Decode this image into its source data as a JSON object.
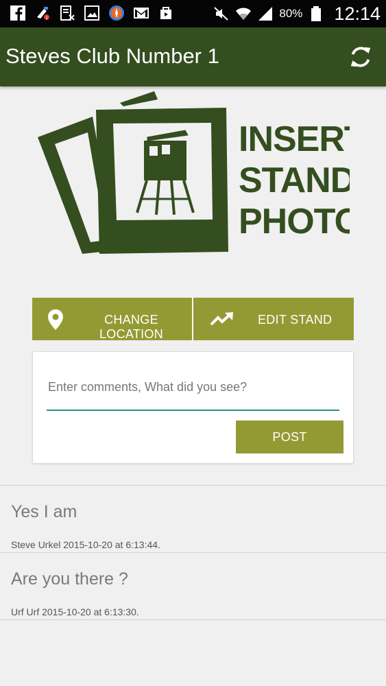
{
  "status_bar": {
    "battery": "80%",
    "time": "12:14",
    "icons": [
      "facebook-icon",
      "clean-master-icon",
      "no-sim-icon",
      "gallery-icon",
      "browser-icon",
      "gmail-icon",
      "store-icon",
      "mute-icon",
      "wifi-icon",
      "signal-icon",
      "battery-icon"
    ]
  },
  "app_bar": {
    "title": "Steves Club Number 1",
    "refresh_icon": "refresh-icon"
  },
  "stand_photo": {
    "lines": [
      "INSERT",
      "STAND",
      "PHOTO"
    ],
    "color": "#344e1f"
  },
  "actions": {
    "change_location_label": "CHANGE LOCATION",
    "change_location_icon": "location-pin-icon",
    "edit_stand_label": "EDIT STAND",
    "edit_stand_icon": "trending-up-icon",
    "button_color": "#949a33"
  },
  "comment": {
    "placeholder": "Enter comments, What did you see?",
    "value": "",
    "post_label": "POST",
    "accent": "#1f948a"
  },
  "posts": [
    {
      "message": "Yes I am",
      "meta": "Steve Urkel 2015-10-20 at 6:13:44."
    },
    {
      "message": "Are you there ?",
      "meta": "Urf Urf 2015-10-20 at 6:13:30."
    }
  ]
}
